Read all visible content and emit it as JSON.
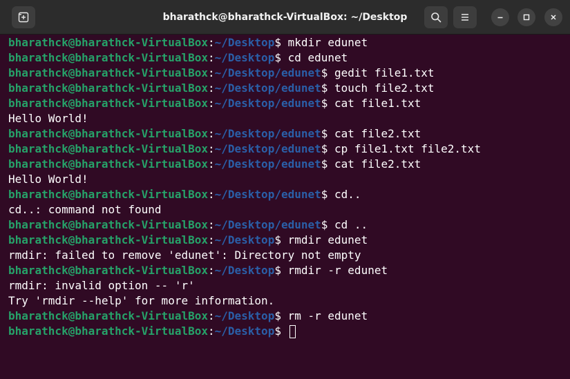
{
  "window": {
    "title": "bharathck@bharathck-VirtualBox: ~/Desktop"
  },
  "titlebar": {
    "new_tab_icon": "new-tab-icon",
    "search_icon": "search-icon",
    "menu_icon": "hamburger-menu-icon",
    "minimize_icon": "minimize-icon",
    "maximize_icon": "maximize-icon",
    "close_icon": "close-icon"
  },
  "colors": {
    "background": "#300a24",
    "prompt_user": "#26a269",
    "prompt_path": "#2a5fa8",
    "text": "#ffffff"
  },
  "terminal": {
    "lines": [
      {
        "type": "prompt",
        "user": "bharathck@bharathck-VirtualBox",
        "colon": ":",
        "path": "~/Desktop",
        "dollar": "$",
        "command": " mkdir edunet"
      },
      {
        "type": "prompt",
        "user": "bharathck@bharathck-VirtualBox",
        "colon": ":",
        "path": "~/Desktop",
        "dollar": "$",
        "command": " cd edunet"
      },
      {
        "type": "prompt",
        "user": "bharathck@bharathck-VirtualBox",
        "colon": ":",
        "path": "~/Desktop/edunet",
        "dollar": "$",
        "command": " gedit file1.txt"
      },
      {
        "type": "prompt",
        "user": "bharathck@bharathck-VirtualBox",
        "colon": ":",
        "path": "~/Desktop/edunet",
        "dollar": "$",
        "command": " touch file2.txt"
      },
      {
        "type": "prompt",
        "user": "bharathck@bharathck-VirtualBox",
        "colon": ":",
        "path": "~/Desktop/edunet",
        "dollar": "$",
        "command": " cat file1.txt"
      },
      {
        "type": "output",
        "text": "Hello World!"
      },
      {
        "type": "prompt",
        "user": "bharathck@bharathck-VirtualBox",
        "colon": ":",
        "path": "~/Desktop/edunet",
        "dollar": "$",
        "command": " cat file2.txt"
      },
      {
        "type": "prompt",
        "user": "bharathck@bharathck-VirtualBox",
        "colon": ":",
        "path": "~/Desktop/edunet",
        "dollar": "$",
        "command": " cp file1.txt file2.txt"
      },
      {
        "type": "prompt",
        "user": "bharathck@bharathck-VirtualBox",
        "colon": ":",
        "path": "~/Desktop/edunet",
        "dollar": "$",
        "command": " cat file2.txt"
      },
      {
        "type": "output",
        "text": "Hello World!"
      },
      {
        "type": "prompt",
        "user": "bharathck@bharathck-VirtualBox",
        "colon": ":",
        "path": "~/Desktop/edunet",
        "dollar": "$",
        "command": " cd.."
      },
      {
        "type": "output",
        "text": "cd..: command not found"
      },
      {
        "type": "prompt",
        "user": "bharathck@bharathck-VirtualBox",
        "colon": ":",
        "path": "~/Desktop/edunet",
        "dollar": "$",
        "command": " cd .."
      },
      {
        "type": "prompt",
        "user": "bharathck@bharathck-VirtualBox",
        "colon": ":",
        "path": "~/Desktop",
        "dollar": "$",
        "command": " rmdir edunet"
      },
      {
        "type": "output",
        "text": "rmdir: failed to remove 'edunet': Directory not empty"
      },
      {
        "type": "prompt",
        "user": "bharathck@bharathck-VirtualBox",
        "colon": ":",
        "path": "~/Desktop",
        "dollar": "$",
        "command": " rmdir -r edunet"
      },
      {
        "type": "output",
        "text": "rmdir: invalid option -- 'r'"
      },
      {
        "type": "output",
        "text": "Try 'rmdir --help' for more information."
      },
      {
        "type": "prompt",
        "user": "bharathck@bharathck-VirtualBox",
        "colon": ":",
        "path": "~/Desktop",
        "dollar": "$",
        "command": " rm -r edunet"
      },
      {
        "type": "current",
        "user": "bharathck@bharathck-VirtualBox",
        "colon": ":",
        "path": "~/Desktop",
        "dollar": "$",
        "command": " "
      }
    ]
  }
}
